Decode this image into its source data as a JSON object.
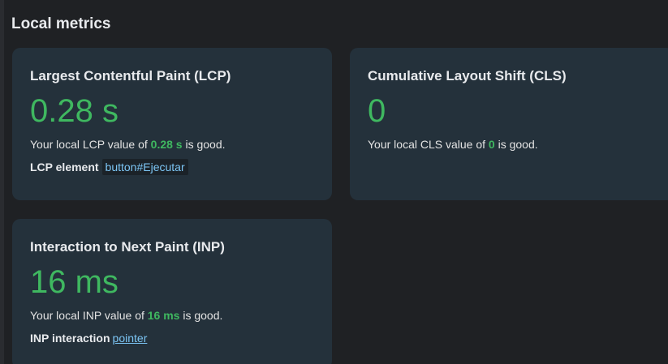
{
  "section": {
    "title": "Local metrics"
  },
  "lcp": {
    "title": "Largest Contentful Paint (LCP)",
    "value": "0.28 s",
    "desc_prefix": "Your local LCP value of ",
    "desc_value": "0.28 s",
    "desc_suffix": " is good.",
    "extra_label": "LCP element",
    "extra_value": "button#Ejecutar"
  },
  "cls": {
    "title": "Cumulative Layout Shift (CLS)",
    "value": "0",
    "desc_prefix": "Your local CLS value of ",
    "desc_value": "0",
    "desc_suffix": " is good."
  },
  "inp": {
    "title": "Interaction to Next Paint (INP)",
    "value": "16 ms",
    "desc_prefix": "Your local INP value of ",
    "desc_value": "16 ms",
    "desc_suffix": " is good.",
    "extra_label": "INP interaction",
    "extra_value": "pointer"
  },
  "colors": {
    "good": "#3fb860",
    "link": "#7cc5f4",
    "card_bg": "#24313b",
    "page_bg": "#1f2124"
  }
}
